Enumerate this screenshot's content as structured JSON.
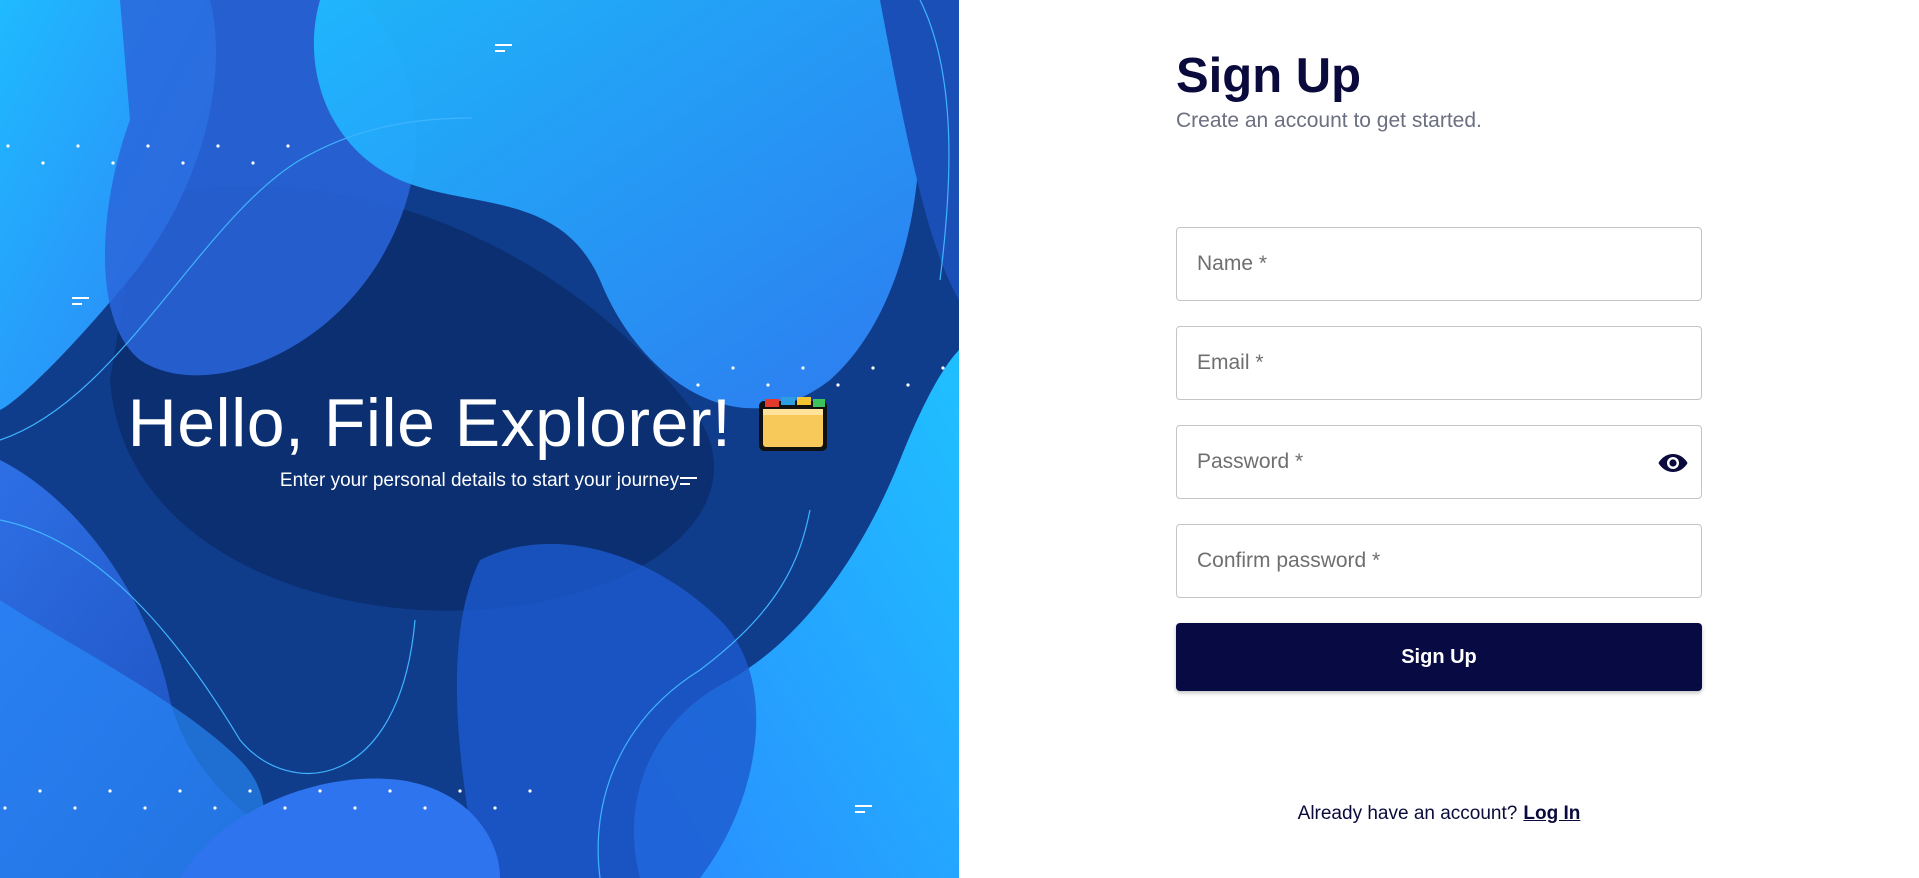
{
  "hero": {
    "title": "Hello, File Explorer!",
    "subtitle": "Enter your personal details to start your journey",
    "icon": "folder-icon"
  },
  "form": {
    "title": "Sign Up",
    "subtitle": "Create an account to get started.",
    "fields": {
      "name": {
        "placeholder": "Name *",
        "value": ""
      },
      "email": {
        "placeholder": "Email *",
        "value": ""
      },
      "password": {
        "placeholder": "Password *",
        "value": "",
        "toggle_icon": "eye-icon"
      },
      "confirm_password": {
        "placeholder": "Confirm password *",
        "value": ""
      }
    },
    "submit_label": "Sign Up"
  },
  "footer": {
    "prompt": "Already have an account?",
    "link_label": "Log In"
  },
  "colors": {
    "accent": "#080a44",
    "hero_dark": "#0d3a86",
    "hero_light": "#1fb6ff"
  }
}
